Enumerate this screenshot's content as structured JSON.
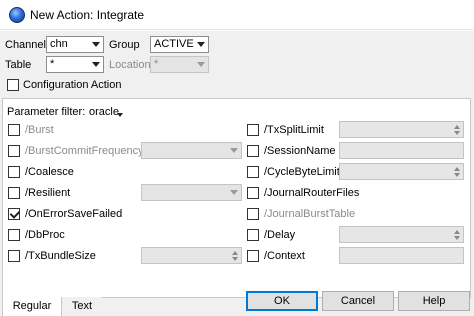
{
  "window": {
    "title": "New Action: Integrate",
    "app_icon": "globe-icon"
  },
  "header": {
    "channel_label": "Channel",
    "channel_value": "chn",
    "group_label": "Group",
    "group_value": "ACTIVE",
    "table_label": "Table",
    "table_value": "*",
    "location_label": "Location",
    "location_value": "*",
    "config_action_label": "Configuration Action"
  },
  "parameters": {
    "filter_label": "Parameter filter:",
    "filter_value": "oracle",
    "items": [
      {
        "label": "/Burst",
        "checked": false,
        "disabled": true
      },
      {
        "label": "/BurstCommitFrequency",
        "checked": false,
        "disabled": true
      },
      {
        "label": "/Coalesce",
        "checked": false,
        "disabled": false
      },
      {
        "label": "/Resilient",
        "checked": false,
        "disabled": false
      },
      {
        "label": "/OnErrorSaveFailed",
        "checked": true,
        "disabled": false
      },
      {
        "label": "/DbProc",
        "checked": false,
        "disabled": false
      },
      {
        "label": "/TxBundleSize",
        "checked": false,
        "disabled": false
      },
      {
        "label": "/TxSplitLimit",
        "checked": false,
        "disabled": false
      },
      {
        "label": "/SessionName",
        "checked": false,
        "disabled": false
      },
      {
        "label": "/CycleByteLimit",
        "checked": false,
        "disabled": false
      },
      {
        "label": "/JournalRouterFiles",
        "checked": false,
        "disabled": false
      },
      {
        "label": "/JournalBurstTable",
        "checked": false,
        "disabled": true
      },
      {
        "label": "/Delay",
        "checked": false,
        "disabled": false
      },
      {
        "label": "/Context",
        "checked": false,
        "disabled": false
      }
    ]
  },
  "tabs": [
    {
      "label": "Regular",
      "active": true
    },
    {
      "label": "Text",
      "active": false
    }
  ],
  "buttons": {
    "ok": "OK",
    "cancel": "Cancel",
    "help": "Help"
  }
}
